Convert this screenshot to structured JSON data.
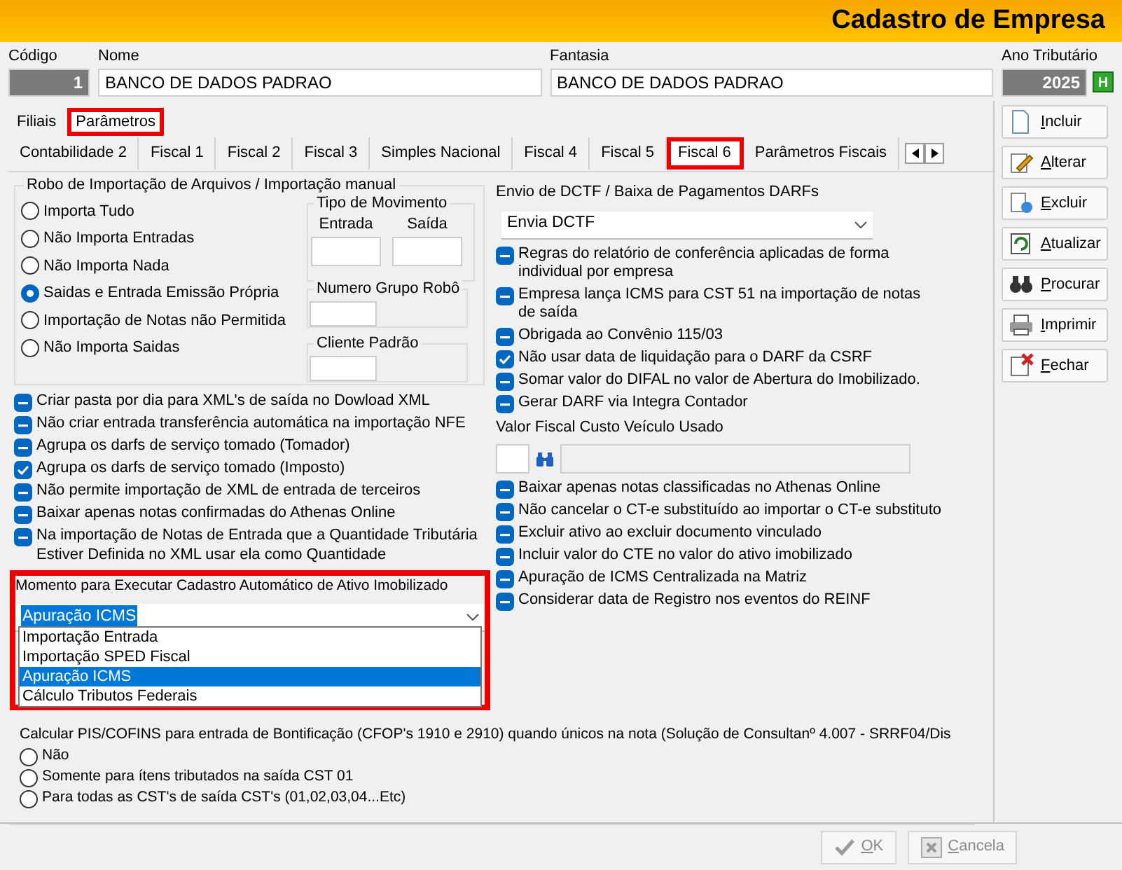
{
  "window": {
    "title": "Cadastro de Empresa"
  },
  "header_fields": [
    {
      "kind": "code",
      "label": "Código",
      "value": "1"
    },
    {
      "kind": "text",
      "label": "Nome",
      "value": "BANCO DE DADOS PADRAO"
    },
    {
      "kind": "text",
      "label": "Fantasia",
      "value": "BANCO DE DADOS PADRAO"
    },
    {
      "kind": "year",
      "label": "Ano Tributário",
      "value": "2025",
      "button": "H"
    }
  ],
  "top_tabs": [
    {
      "label": "Filiais",
      "selected": false,
      "highlighted": false
    },
    {
      "label": "Parâmetros",
      "selected": true,
      "highlighted": true
    }
  ],
  "sub_tabs": [
    {
      "label": "Contabilidade 2",
      "selected": false,
      "highlighted": false
    },
    {
      "label": "Fiscal 1",
      "selected": false,
      "highlighted": false
    },
    {
      "label": "Fiscal 2",
      "selected": false,
      "highlighted": false
    },
    {
      "label": "Fiscal 3",
      "selected": false,
      "highlighted": false
    },
    {
      "label": "Simples Nacional",
      "selected": false,
      "highlighted": false
    },
    {
      "label": "Fiscal 4",
      "selected": false,
      "highlighted": false
    },
    {
      "label": "Fiscal 5",
      "selected": false,
      "highlighted": false
    },
    {
      "label": "Fiscal 6",
      "selected": true,
      "highlighted": true
    },
    {
      "label": "Parâmetros Fiscais",
      "selected": false,
      "highlighted": false
    }
  ],
  "robot_group": {
    "title": "Robo de Importação de Arquivos /  Importação manual",
    "options": [
      {
        "label": "Importa Tudo",
        "selected": false
      },
      {
        "label": "Não Importa Entradas",
        "selected": false
      },
      {
        "label": "Não Importa Nada",
        "selected": false
      },
      {
        "label": "Saidas e Entrada Emissão Própria",
        "selected": true
      },
      {
        "label": "Importação de Notas não Permitida",
        "selected": false
      },
      {
        "label": "Não Importa Saidas",
        "selected": false
      }
    ],
    "movement": {
      "title": "Tipo de Movimento",
      "columns": [
        "Entrada",
        "Saída"
      ]
    },
    "group_number": {
      "label": "Numero Grupo Robô"
    },
    "default_client": {
      "label": "Cliente Padrão"
    }
  },
  "left_checks": [
    {
      "label": "Criar pasta por dia para XML's de saída no Dowload XML",
      "checked": false,
      "indeterminate": true
    },
    {
      "label": "Não criar entrada transferência automática na importação NFE",
      "checked": false,
      "indeterminate": true
    },
    {
      "label": "Agrupa os darfs de serviço tomado (Tomador)",
      "checked": false,
      "indeterminate": true
    },
    {
      "label": "Agrupa os darfs de serviço tomado (Imposto)",
      "checked": true,
      "indeterminate": false
    },
    {
      "label": "Não permite importação de XML de entrada de terceiros",
      "checked": false,
      "indeterminate": true
    },
    {
      "label": "Baixar apenas notas confirmadas do Athenas Online",
      "checked": false,
      "indeterminate": true
    },
    {
      "label": "Na importação de Notas de Entrada que a Quantidade Tributária Estiver Definida no XML usar ela como Quantidade",
      "checked": false,
      "indeterminate": true
    }
  ],
  "asset_moment": {
    "label": "Momento para Executar Cadastro Automático de Ativo Imobilizado",
    "value": "Apuração ICMS",
    "highlighted": true,
    "expanded": true,
    "options": [
      {
        "label": "Importação Entrada",
        "selected": false
      },
      {
        "label": "Importação SPED Fiscal",
        "selected": false
      },
      {
        "label": "Apuração ICMS",
        "selected": true
      },
      {
        "label": "Cálculo Tributos Federais",
        "selected": false
      }
    ]
  },
  "dctf": {
    "label": "Envio de DCTF / Baixa de Pagamentos DARFs",
    "value": "Envia DCTF"
  },
  "right_checks": [
    {
      "label": "Regras do relatório de  conferência aplicadas de forma individual por empresa",
      "checked": false,
      "indeterminate": true
    },
    {
      "label": "Empresa lança ICMS para CST 51 na importação de notas de saída",
      "checked": false,
      "indeterminate": true
    },
    {
      "label": "Obrigada ao Convênio 115/03",
      "checked": false,
      "indeterminate": true
    },
    {
      "label": "Não usar data de liquidação para o DARF da CSRF",
      "checked": true,
      "indeterminate": false
    },
    {
      "label": "Somar valor do DIFAL no valor de Abertura do Imobilizado.",
      "checked": false,
      "indeterminate": true
    },
    {
      "label": "Gerar DARF via Integra Contador",
      "checked": false,
      "indeterminate": true
    }
  ],
  "vehicle": {
    "label": "Valor Fiscal Custo Veículo Usado"
  },
  "right_checks_2": [
    {
      "label": "Baixar apenas notas classificadas no Athenas Online",
      "checked": false,
      "indeterminate": true
    },
    {
      "label": "Não cancelar o CT-e substituído ao importar o CT-e substituto",
      "checked": false,
      "indeterminate": true
    },
    {
      "label": "Excluir ativo ao excluir documento vinculado",
      "checked": false,
      "indeterminate": true
    },
    {
      "label": "Incluir valor do CTE no valor do ativo imobilizado",
      "checked": false,
      "indeterminate": true
    },
    {
      "label": "Apuração de ICMS Centralizada na Matriz",
      "checked": false,
      "indeterminate": true
    },
    {
      "label": "Considerar data de Registro nos eventos do REINF",
      "checked": false,
      "indeterminate": true
    }
  ],
  "bonus": {
    "title": "Calcular PIS/COFINS para entrada de Bontificação (CFOP's 1910 e 2910) quando únicos na nota (Solução de Consultanº 4.007 - SRRF04/Dis",
    "options": [
      {
        "label": "Não",
        "selected": false
      },
      {
        "label": "Somente para ítens tributados na saída CST 01",
        "selected": false
      },
      {
        "label": "Para todas as CST's de saída CST's (01,02,03,04...Etc)",
        "selected": false
      }
    ]
  },
  "side_buttons": [
    {
      "kind": "new",
      "label": "Incluir"
    },
    {
      "kind": "edit",
      "label": "Alterar"
    },
    {
      "kind": "delete",
      "label": "Excluir"
    },
    {
      "kind": "refresh",
      "label": "Atualizar"
    },
    {
      "kind": "search",
      "label": "Procurar"
    },
    {
      "kind": "print",
      "label": "Imprimir"
    },
    {
      "kind": "close",
      "label": "Fechar"
    }
  ],
  "footer_buttons": [
    {
      "kind": "ok",
      "label": "OK",
      "disabled": true
    },
    {
      "kind": "cancel",
      "label": "Cancela",
      "disabled": true
    }
  ]
}
